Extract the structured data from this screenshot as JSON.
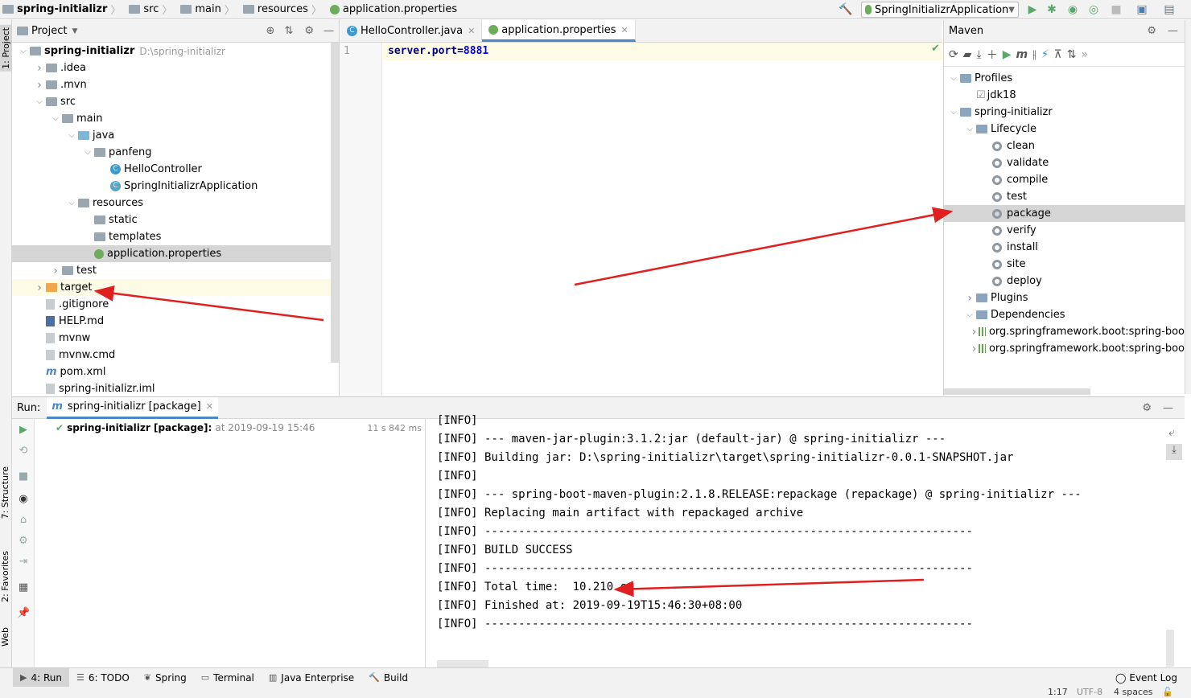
{
  "breadcrumb": [
    "spring-initializr",
    "src",
    "main",
    "resources",
    "application.properties"
  ],
  "run_config": "SpringInitializrApplication",
  "left_strip": {
    "project": "1: Project",
    "structure": "7: Structure",
    "favorites": "2: Favorites",
    "web": "Web"
  },
  "project_panel": {
    "title": "Project",
    "tree": [
      {
        "label": "spring-initializr",
        "suffix": "D:\\spring-initializr",
        "level": 0,
        "expanded": true,
        "icon": "module-folder"
      },
      {
        "label": ".idea",
        "level": 1,
        "expanded": false,
        "icon": "folder"
      },
      {
        "label": ".mvn",
        "level": 1,
        "expanded": false,
        "icon": "folder"
      },
      {
        "label": "src",
        "level": 1,
        "expanded": true,
        "icon": "folder"
      },
      {
        "label": "main",
        "level": 2,
        "expanded": true,
        "icon": "folder"
      },
      {
        "label": "java",
        "level": 3,
        "expanded": true,
        "icon": "source-folder"
      },
      {
        "label": "panfeng",
        "level": 4,
        "expanded": true,
        "icon": "package"
      },
      {
        "label": "HelloController",
        "level": 5,
        "icon": "class"
      },
      {
        "label": "SpringInitializrApplication",
        "level": 5,
        "icon": "spring-class"
      },
      {
        "label": "resources",
        "level": 3,
        "expanded": true,
        "icon": "resources-folder"
      },
      {
        "label": "static",
        "level": 4,
        "icon": "folder"
      },
      {
        "label": "templates",
        "level": 4,
        "icon": "folder"
      },
      {
        "label": "application.properties",
        "level": 4,
        "icon": "spring-file",
        "selected": true
      },
      {
        "label": "test",
        "level": 2,
        "expanded": false,
        "icon": "folder"
      },
      {
        "label": "target",
        "level": 1,
        "expanded": false,
        "icon": "excluded-folder",
        "highlighted": true
      },
      {
        "label": ".gitignore",
        "level": 1,
        "icon": "file"
      },
      {
        "label": "HELP.md",
        "level": 1,
        "icon": "md-file"
      },
      {
        "label": "mvnw",
        "level": 1,
        "icon": "shell-file"
      },
      {
        "label": "mvnw.cmd",
        "level": 1,
        "icon": "file"
      },
      {
        "label": "pom.xml",
        "level": 1,
        "icon": "maven-file"
      },
      {
        "label": "spring-initializr.iml",
        "level": 1,
        "icon": "file"
      }
    ]
  },
  "editor": {
    "tabs": [
      {
        "label": "HelloController.java",
        "active": false
      },
      {
        "label": "application.properties",
        "active": true
      }
    ],
    "line_number": "1",
    "code_key": "server.port",
    "code_eq": "=",
    "code_value": "8881"
  },
  "maven": {
    "title": "Maven",
    "tree": [
      {
        "label": "Profiles",
        "level": 0,
        "expanded": true,
        "icon": "profiles"
      },
      {
        "label": "jdk18",
        "level": 1,
        "icon": "checkbox"
      },
      {
        "label": "spring-initializr",
        "level": 0,
        "expanded": true,
        "icon": "maven-module"
      },
      {
        "label": "Lifecycle",
        "level": 1,
        "expanded": true,
        "icon": "lifecycle"
      },
      {
        "label": "clean",
        "level": 2,
        "icon": "gear"
      },
      {
        "label": "validate",
        "level": 2,
        "icon": "gear"
      },
      {
        "label": "compile",
        "level": 2,
        "icon": "gear"
      },
      {
        "label": "test",
        "level": 2,
        "icon": "gear"
      },
      {
        "label": "package",
        "level": 2,
        "icon": "gear",
        "selected": true
      },
      {
        "label": "verify",
        "level": 2,
        "icon": "gear"
      },
      {
        "label": "install",
        "level": 2,
        "icon": "gear"
      },
      {
        "label": "site",
        "level": 2,
        "icon": "gear"
      },
      {
        "label": "deploy",
        "level": 2,
        "icon": "gear"
      },
      {
        "label": "Plugins",
        "level": 1,
        "expanded": false,
        "icon": "plugins"
      },
      {
        "label": "Dependencies",
        "level": 1,
        "expanded": true,
        "icon": "dependencies"
      },
      {
        "label": "org.springframework.boot:spring-boo",
        "level": 2,
        "expanded": false,
        "icon": "library"
      },
      {
        "label": "org.springframework.boot:spring-boo",
        "level": 2,
        "expanded": false,
        "icon": "library"
      }
    ]
  },
  "run_panel": {
    "label": "Run:",
    "tab": "spring-initializr [package]",
    "entry_name": "spring-initializr [package]:",
    "entry_time": "at 2019-09-19 15:46",
    "entry_duration": "11 s 842 ms",
    "console": [
      "[INFO]",
      "[INFO] --- maven-jar-plugin:3.1.2:jar (default-jar) @ spring-initializr ---",
      "[INFO] Building jar: D:\\spring-initializr\\target\\spring-initializr-0.0.1-SNAPSHOT.jar",
      "[INFO]",
      "[INFO] --- spring-boot-maven-plugin:2.1.8.RELEASE:repackage (repackage) @ spring-initializr ---",
      "[INFO] Replacing main artifact with repackaged archive",
      "[INFO] ------------------------------------------------------------------------",
      "[INFO] BUILD SUCCESS",
      "[INFO] ------------------------------------------------------------------------",
      "[INFO] Total time:  10.210 s",
      "[INFO] Finished at: 2019-09-19T15:46:30+08:00",
      "[INFO] ------------------------------------------------------------------------"
    ]
  },
  "bottom_tabs": [
    {
      "label": "4: Run",
      "active": true,
      "icon": "run-icon"
    },
    {
      "label": "6: TODO",
      "icon": "todo-icon"
    },
    {
      "label": "Spring",
      "icon": "spring-icon"
    },
    {
      "label": "Terminal",
      "icon": "terminal-icon"
    },
    {
      "label": "Java Enterprise",
      "icon": "java-enterprise-icon"
    },
    {
      "label": "Build",
      "icon": "build-icon"
    }
  ],
  "event_log": "Event Log",
  "status": {
    "position": "1:17",
    "encoding": "UTF-8",
    "indent": "4 spaces"
  },
  "colors": {
    "accent": "#4a88c7",
    "keyword": "#000080",
    "value": "#0000ff",
    "arrow": "#e02020",
    "success": "#59a869"
  }
}
